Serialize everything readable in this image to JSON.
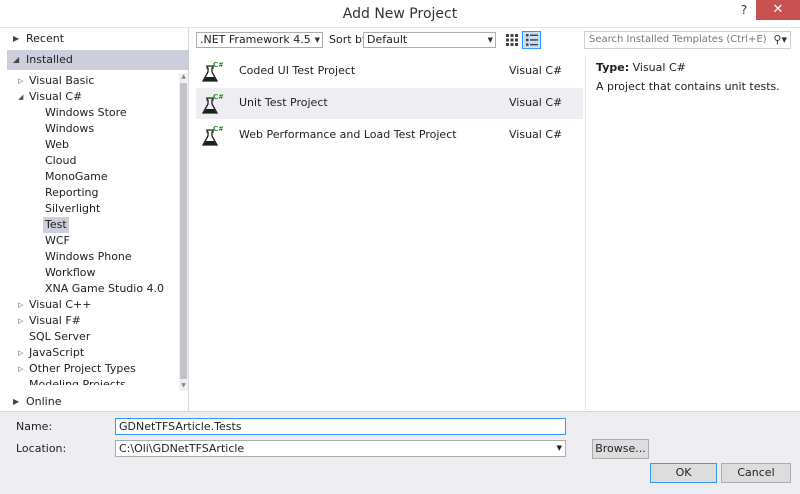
{
  "window": {
    "title": "Add New Project",
    "help_label": "?",
    "close_label": "✕"
  },
  "left": {
    "recent_label": "Recent",
    "installed_label": "Installed",
    "online_label": "Online",
    "tree": [
      {
        "label": "Visual Basic",
        "expander": "▷"
      },
      {
        "label": "Visual C#",
        "expander": "◢"
      },
      {
        "label": "Windows Store"
      },
      {
        "label": "Windows"
      },
      {
        "label": "Web"
      },
      {
        "label": "Cloud"
      },
      {
        "label": "MonoGame"
      },
      {
        "label": "Reporting"
      },
      {
        "label": "Silverlight"
      },
      {
        "label": "Test",
        "selected": true
      },
      {
        "label": "WCF"
      },
      {
        "label": "Windows Phone"
      },
      {
        "label": "Workflow"
      },
      {
        "label": "XNA Game Studio 4.0"
      },
      {
        "label": "Visual C++",
        "expander": "▷"
      },
      {
        "label": "Visual F#",
        "expander": "▷"
      },
      {
        "label": "SQL Server"
      },
      {
        "label": "JavaScript",
        "expander": "▷"
      },
      {
        "label": "Other Project Types",
        "expander": "▷"
      },
      {
        "label": "Modeling Projects"
      }
    ]
  },
  "toolbar": {
    "framework": ".NET Framework 4.5",
    "sort_label": "Sort by:",
    "sort_value": "Default",
    "search_placeholder": "Search Installed Templates (Ctrl+E)"
  },
  "templates": [
    {
      "name": "Coded UI Test Project",
      "lang": "Visual C#"
    },
    {
      "name": "Unit Test Project",
      "lang": "Visual C#",
      "selected": true
    },
    {
      "name": "Web Performance and Load Test Project",
      "lang": "Visual C#"
    }
  ],
  "details": {
    "type_label": "Type:",
    "type_value": "Visual C#",
    "description": "A project that contains unit tests."
  },
  "form": {
    "name_label": "Name:",
    "name_value": "GDNetTFSArticle.Tests",
    "location_label": "Location:",
    "location_value": "C:\\Oli\\GDNetTFSArticle",
    "browse_label": "Browse...",
    "ok_label": "OK",
    "cancel_label": "Cancel"
  },
  "colors": {
    "selection": "#cccedb",
    "accent": "#3399ff",
    "icon_green": "#388a34"
  }
}
